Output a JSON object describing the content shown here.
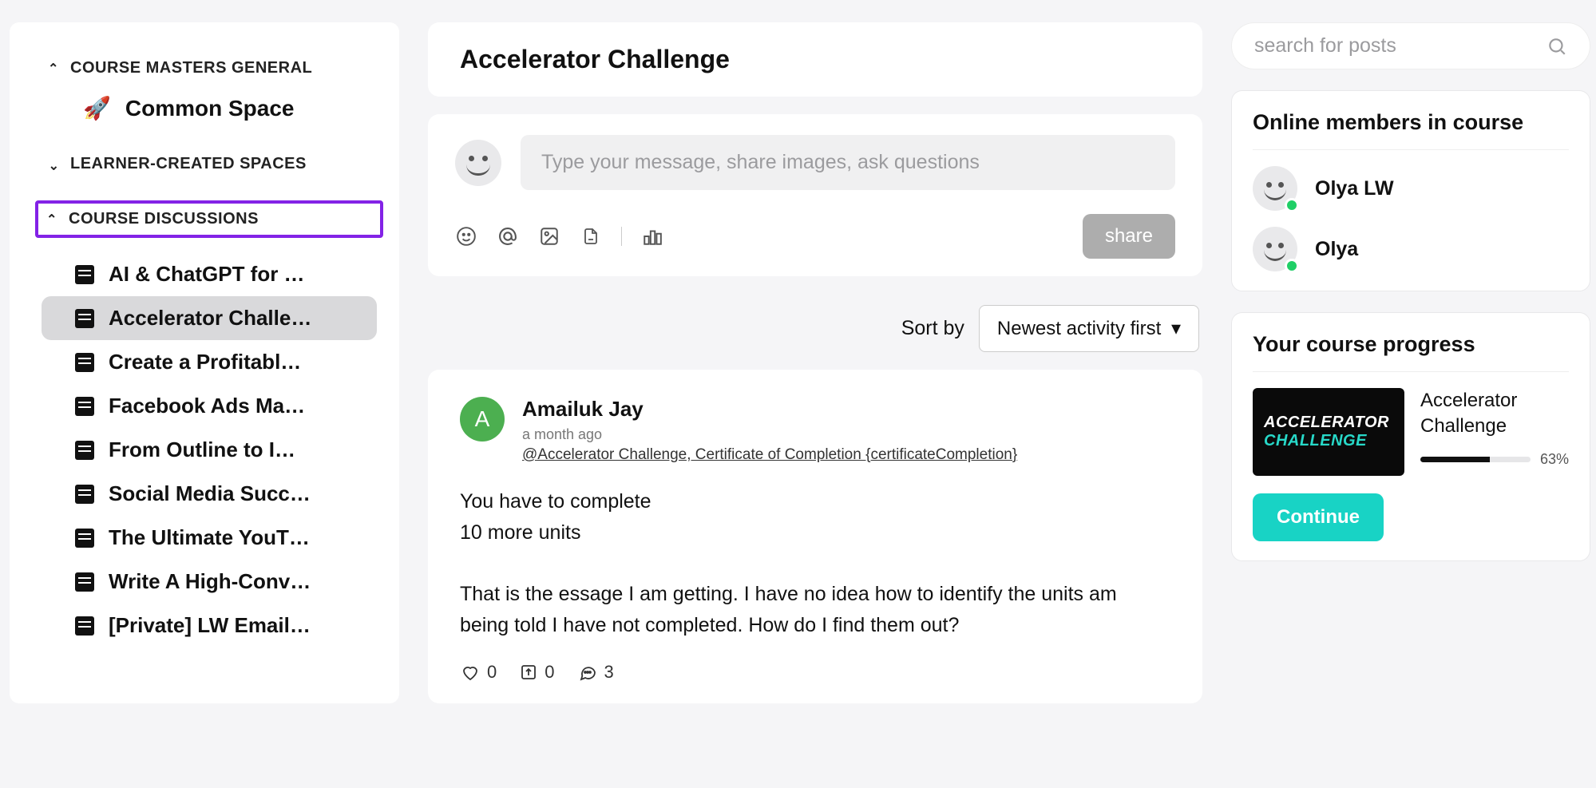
{
  "sidebar": {
    "sections": {
      "general": {
        "label": "COURSE MASTERS GENERAL",
        "expanded": true
      },
      "learner": {
        "label": "LEARNER-CREATED SPACES",
        "expanded": false
      },
      "discussions": {
        "label": "COURSE DISCUSSIONS",
        "expanded": true
      }
    },
    "common_space": "Common Space",
    "discussion_items": [
      "AI & ChatGPT for …",
      "Accelerator Challe…",
      "Create a Profitabl…",
      "Facebook Ads Ma…",
      "From Outline to I…",
      "Social Media Succ…",
      "The Ultimate YouT…",
      "Write A High-Conv…",
      "[Private] LW Email…"
    ],
    "active_index": 1
  },
  "main": {
    "title": "Accelerator Challenge",
    "composer_placeholder": "Type your message, share images, ask questions",
    "share_label": "share",
    "sort_label": "Sort by",
    "sort_value": "Newest activity first",
    "post": {
      "author": "Amailuk Jay",
      "initial": "A",
      "time": "a month ago",
      "context_link": "@Accelerator Challenge, Certificate of Completion {certificateCompletion}",
      "body_l1": "You have to complete",
      "body_l2": "10 more units",
      "body_l3": "That is the essage I am getting. I have no idea how to identify the units am being told I have not completed. How do I find them out?",
      "hearts": "0",
      "shares": "0",
      "comments": "3"
    }
  },
  "right": {
    "search_placeholder": "search for posts",
    "online_title": "Online members in course",
    "members": [
      "Olya LW",
      "Olya"
    ],
    "progress_title": "Your course progress",
    "course_name": "Accelerator Challenge",
    "percent_label": "63%",
    "percent": 63,
    "continue": "Continue",
    "thumb_l1": "ACCELERATOR",
    "thumb_l2": "CHALLENGE"
  }
}
